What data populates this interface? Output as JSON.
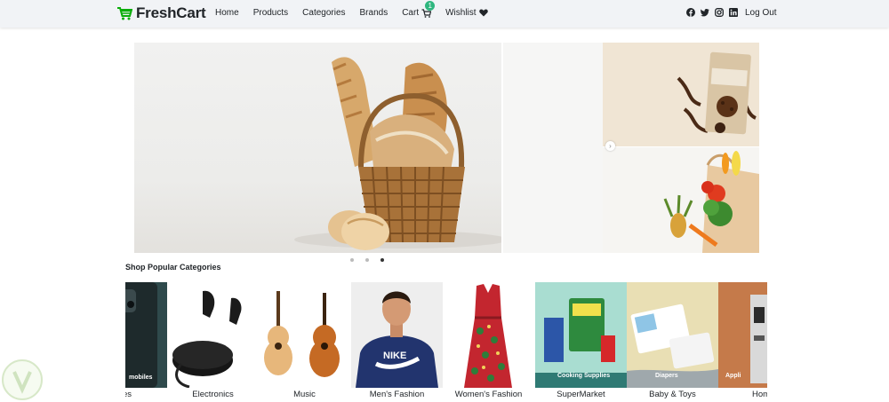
{
  "brand": {
    "name": "FreshCart",
    "icon": "shopping-cart-icon",
    "color": "#0aad0a"
  },
  "nav": {
    "links": [
      "Home",
      "Products",
      "Categories",
      "Brands",
      "Cart",
      "Wishlist"
    ],
    "cart_count": "1",
    "logout_label": "Log Out",
    "social_icons": [
      "facebook-icon",
      "twitter-icon",
      "instagram-icon",
      "linkedin-icon"
    ]
  },
  "slider": {
    "slide_count": 3,
    "active_index": 2,
    "accent": "#2fb67f"
  },
  "categories": {
    "title": "Shop Popular Categories",
    "items": [
      {
        "name": "Mobiles",
        "visible_label": "iles",
        "overlay": "mobiles"
      },
      {
        "name": "Electronics",
        "visible_label": "Electronics",
        "overlay": ""
      },
      {
        "name": "Music",
        "visible_label": "Music",
        "overlay": ""
      },
      {
        "name": "Men's Fashion",
        "visible_label": "Men's Fashion",
        "overlay": ""
      },
      {
        "name": "Women's Fashion",
        "visible_label": "Women's Fashion",
        "overlay": ""
      },
      {
        "name": "SuperMarket",
        "visible_label": "SuperMarket",
        "overlay": "Cooking Supplies"
      },
      {
        "name": "Baby & Toys",
        "visible_label": "Baby & Toys",
        "overlay": "Diapers"
      },
      {
        "name": "Home",
        "visible_label": "Hom",
        "overlay": "Appli"
      }
    ]
  }
}
